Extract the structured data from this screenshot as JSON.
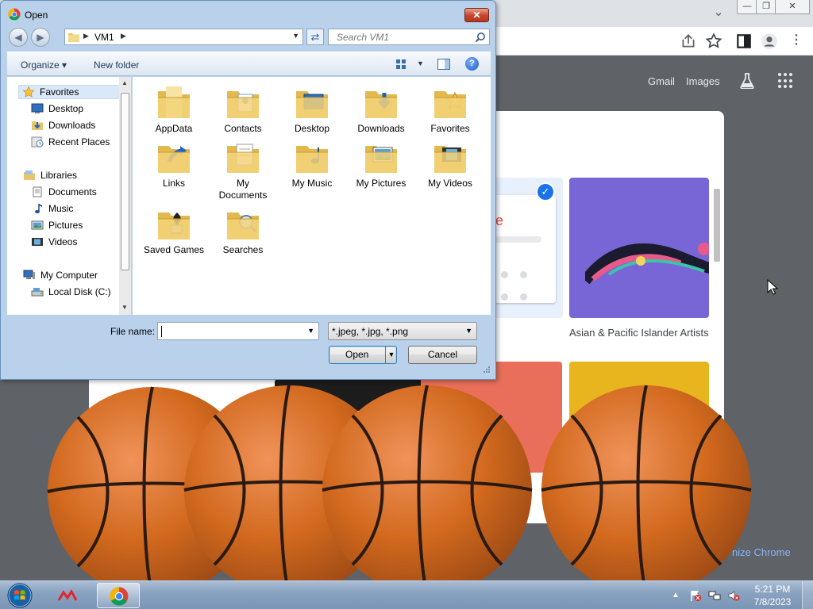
{
  "chrome": {
    "header_links": [
      "Gmail",
      "Images"
    ],
    "google_logo_partial": "gle",
    "tile_caption": "Asian & Pacific Islander Artists",
    "customize_label": "nize Chrome",
    "window_controls": [
      "⌄",
      "—",
      "❐",
      "✕"
    ]
  },
  "dialog": {
    "title": "Open",
    "close_glyph": "✕",
    "address_segments": [
      "VM1"
    ],
    "search_placeholder": "Search VM1",
    "toolbar": {
      "organize": "Organize",
      "new_folder": "New folder",
      "help": "?"
    },
    "nav": {
      "favorites_head": "Favorites",
      "favorites": [
        "Desktop",
        "Downloads",
        "Recent Places"
      ],
      "libraries_head": "Libraries",
      "libraries": [
        "Documents",
        "Music",
        "Pictures",
        "Videos"
      ],
      "computer_head": "My Computer",
      "computer": [
        "Local Disk (C:)"
      ]
    },
    "files": [
      {
        "name": "AppData",
        "icon": "folder-icon"
      },
      {
        "name": "Contacts",
        "icon": "contacts-folder-icon"
      },
      {
        "name": "Desktop",
        "icon": "desktop-folder-icon"
      },
      {
        "name": "Downloads",
        "icon": "downloads-folder-icon"
      },
      {
        "name": "Favorites",
        "icon": "favorites-folder-icon"
      },
      {
        "name": "Links",
        "icon": "links-folder-icon"
      },
      {
        "name": "My Documents",
        "icon": "documents-folder-icon"
      },
      {
        "name": "My Music",
        "icon": "music-folder-icon"
      },
      {
        "name": "My Pictures",
        "icon": "pictures-folder-icon"
      },
      {
        "name": "My Videos",
        "icon": "videos-folder-icon"
      },
      {
        "name": "Saved Games",
        "icon": "saved-games-folder-icon"
      },
      {
        "name": "Searches",
        "icon": "searches-folder-icon"
      }
    ],
    "file_name_label": "File name:",
    "file_name_value": "",
    "file_type": "*.jpeg, *.jpg, *.png",
    "open_label": "Open",
    "cancel_label": "Cancel"
  },
  "taskbar": {
    "time": "5:21 PM",
    "date": "7/8/2023"
  },
  "colors": {
    "accent": "#1a73e8",
    "chrome_bg": "#5f6368",
    "dialog_frame": "#b9d1ea",
    "basketball": "#d2691e"
  }
}
